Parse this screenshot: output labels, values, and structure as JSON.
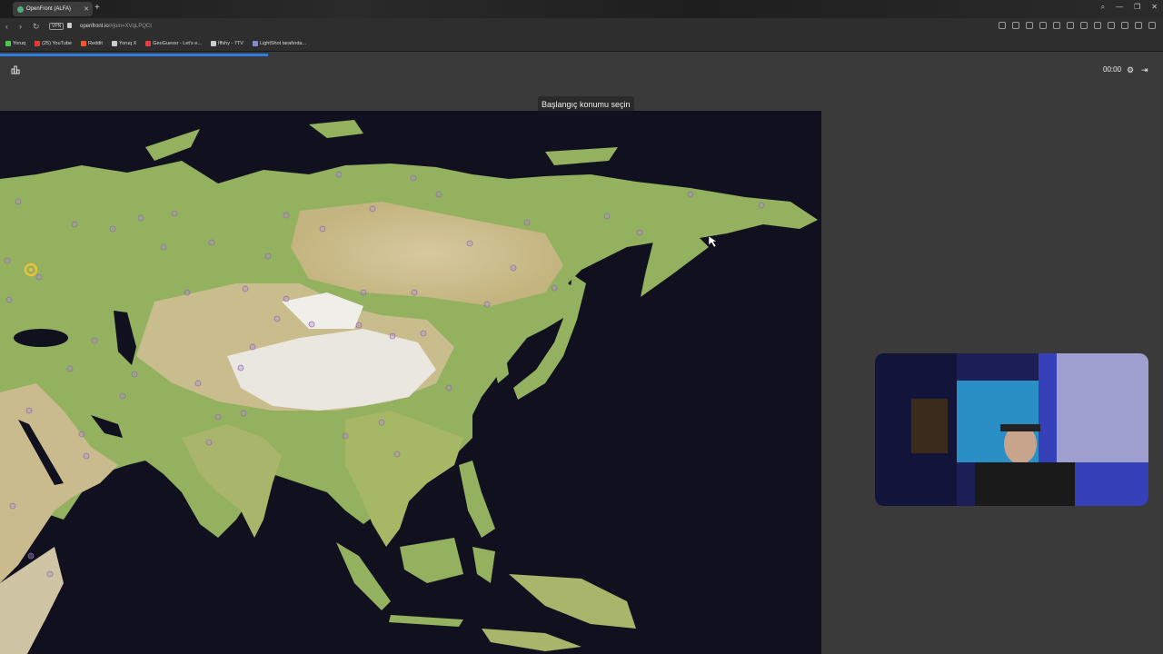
{
  "browser": {
    "tab_title": "OpenFront (ALFA)",
    "url_host": "openfront.io",
    "url_path": "/#join=XVqLPQCt",
    "vpn_badge": "VPN",
    "bookmarks": [
      {
        "label": "Yoruq",
        "color": "#53c653"
      },
      {
        "label": "(25) YouTube",
        "color": "#e53935"
      },
      {
        "label": "Reddit",
        "color": "#ff5722"
      },
      {
        "label": "Yoruq X",
        "color": "#cccccc"
      },
      {
        "label": "GeoGuessr - Let's e...",
        "color": "#e04040"
      },
      {
        "label": "Iffshy - 7TV",
        "color": "#cccccc"
      },
      {
        "label": "LightShot tarafında...",
        "color": "#8888cc"
      }
    ]
  },
  "game": {
    "timer": "00:00",
    "banner": "Başlangıç konumu seçin",
    "colors": {
      "ocean": "#11101f",
      "land_green": "#93b15f",
      "land_tan": "#c7b98c",
      "mountain": "#e8e6df",
      "background": "#3a3a3a"
    }
  }
}
